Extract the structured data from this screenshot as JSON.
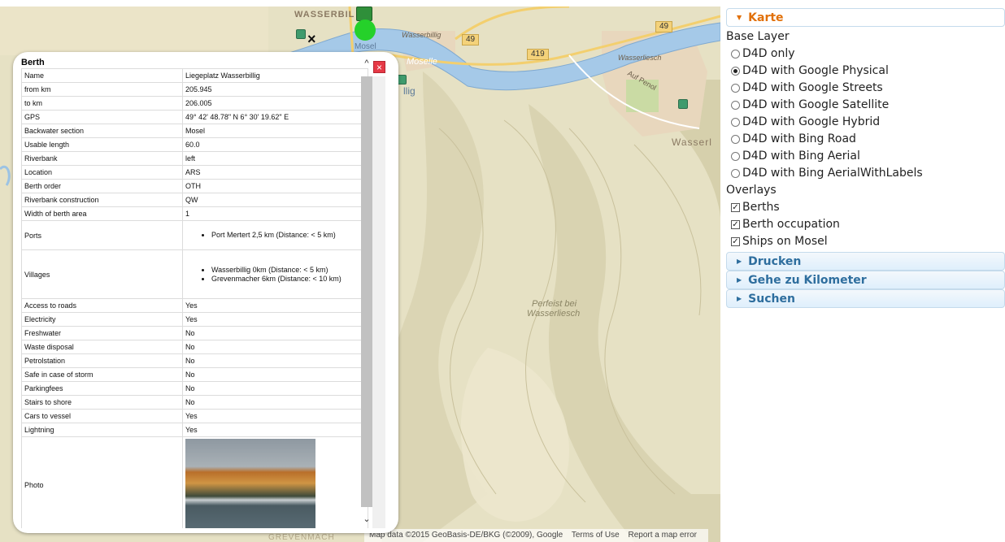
{
  "map": {
    "labels": {
      "town_top": "WASSERBIL",
      "wasserbillig_small": "Wasserbillig",
      "moselle": "Moselle",
      "mosel": "Mosel",
      "wasserliesch_small": "Wasserliesch",
      "auf_penol": "Auf Penol",
      "wasserl_right": "Wasserl",
      "perfeist": "Perfeist bei",
      "perfeist2": "Wasserliesch",
      "bottom_town": "GREVENMACH",
      "tig": "llig"
    },
    "road_shields": [
      "49",
      "419",
      "49"
    ],
    "close_symbol": "×",
    "attribution": {
      "data": "Map data ©2015 GeoBasis-DE/BKG (©2009), Google",
      "terms": "Terms of Use",
      "report": "Report a map error"
    }
  },
  "popup": {
    "title": "Berth",
    "close_symbol": "×",
    "scroll_up": "^",
    "scroll_down": "⌄",
    "rows": [
      {
        "label": "Name",
        "value": "Liegeplatz Wasserbillig"
      },
      {
        "label": "from km",
        "value": "205.945"
      },
      {
        "label": "to km",
        "value": "206.005"
      },
      {
        "label": "GPS",
        "value": "49° 42' 48.78\" N 6° 30' 19.62\" E"
      },
      {
        "label": "Backwater section",
        "value": "Mosel"
      },
      {
        "label": "Usable length",
        "value": "60.0"
      },
      {
        "label": "Riverbank",
        "value": "left"
      },
      {
        "label": "Location",
        "value": "ARS"
      },
      {
        "label": "Berth order",
        "value": "OTH"
      },
      {
        "label": "Riverbank construction",
        "value": "QW"
      },
      {
        "label": "Width of berth area",
        "value": "1"
      }
    ],
    "ports": {
      "label": "Ports",
      "items": [
        "Port Mertert 2,5 km (Distance: < 5 km)"
      ]
    },
    "villages": {
      "label": "Villages",
      "items": [
        "Wasserbillig 0km (Distance: < 5 km)",
        "Grevenmacher 6km (Distance: < 10 km)"
      ]
    },
    "rows2": [
      {
        "label": "Access to roads",
        "value": "Yes"
      },
      {
        "label": "Electricity",
        "value": "Yes"
      },
      {
        "label": "Freshwater",
        "value": "No"
      },
      {
        "label": "Waste disposal",
        "value": "No"
      },
      {
        "label": "Petrolstation",
        "value": "No"
      },
      {
        "label": "Safe in case of storm",
        "value": "No"
      },
      {
        "label": "Parkingfees",
        "value": "No"
      },
      {
        "label": "Stairs to shore",
        "value": "No"
      },
      {
        "label": "Cars to vessel",
        "value": "Yes"
      },
      {
        "label": "Lightning",
        "value": "Yes"
      }
    ],
    "photo_label": "Photo"
  },
  "sidebar": {
    "karte": {
      "title": "Karte",
      "base_layer_heading": "Base Layer",
      "base_layers": [
        {
          "label": "D4D only",
          "selected": false
        },
        {
          "label": "D4D with Google Physical",
          "selected": true
        },
        {
          "label": "D4D with Google Streets",
          "selected": false
        },
        {
          "label": "D4D with Google Satellite",
          "selected": false
        },
        {
          "label": "D4D with Google Hybrid",
          "selected": false
        },
        {
          "label": "D4D with Bing Road",
          "selected": false
        },
        {
          "label": "D4D with Bing Aerial",
          "selected": false
        },
        {
          "label": "D4D with Bing AerialWithLabels",
          "selected": false
        }
      ],
      "overlays_heading": "Overlays",
      "overlays": [
        {
          "label": "Berths",
          "checked": true
        },
        {
          "label": "Berth occupation",
          "checked": true
        },
        {
          "label": "Ships on Mosel",
          "checked": true
        }
      ]
    },
    "drucken": "Drucken",
    "gehe": "Gehe zu Kilometer",
    "suchen": "Suchen",
    "check_mark": "✓",
    "tri_open": "▼",
    "tri_closed": "▶"
  },
  "colors": {
    "accent_active": "#e17009",
    "accordion_text": "#2e6e9e",
    "river": "#a5c9e8",
    "terrain": "#e7e2c7",
    "close_red": "#e63946"
  }
}
